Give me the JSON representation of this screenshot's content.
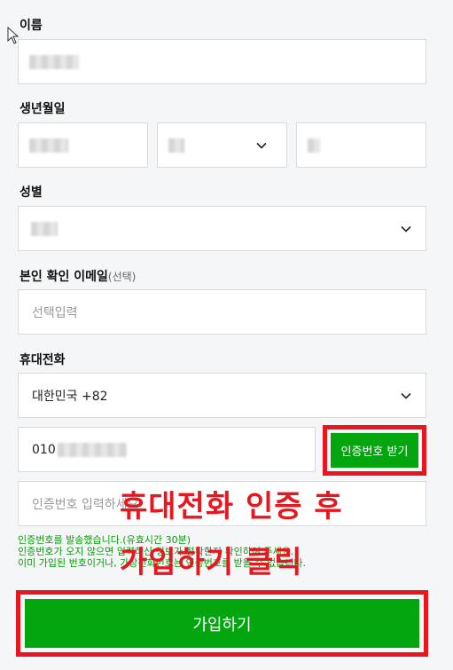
{
  "name": {
    "label": "이름"
  },
  "birth": {
    "label": "생년월일"
  },
  "gender": {
    "label": "성별"
  },
  "email": {
    "label": "본인 확인 이메일",
    "label_sub": "(선택)",
    "placeholder": "선택입력"
  },
  "phone": {
    "label": "휴대전화",
    "country": "대한민국 +82",
    "number_prefix": "010",
    "verify_button": "인증번호 받기",
    "code_placeholder": "인증번호 입력하세요"
  },
  "messages": [
    "인증번호를 발송했습니다.(유효시간 30분)",
    "인증번호가 오지 않으면 입력하신 정보가 정확한지 확인하여 주세요.",
    "이미 가입된 번호이거나, 가상전화번호는 인증번호를 받을 수 없습니다."
  ],
  "annotation": {
    "line1": "휴대전화 인증 후",
    "line2": "가입하기 클릭"
  },
  "submit": {
    "label": "가입하기"
  },
  "colors": {
    "accent": "#03a60f",
    "annotation": "#e8161f"
  },
  "icons": {
    "cursor": "arrow-cursor-icon",
    "chevron": "chevron-down-icon"
  }
}
